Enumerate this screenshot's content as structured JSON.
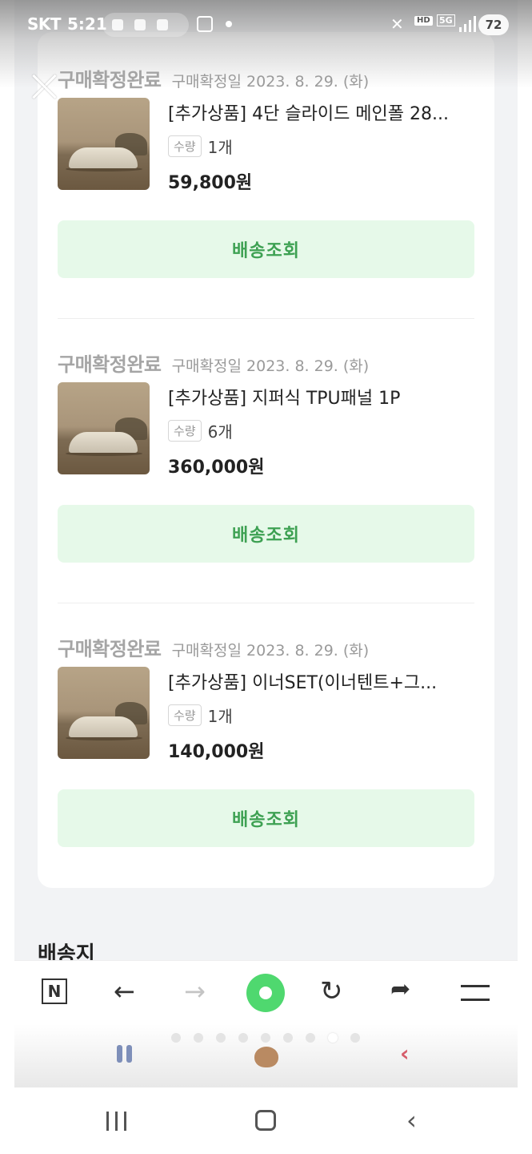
{
  "status_bar": {
    "carrier": "SKT",
    "time": "5:21",
    "hd": "HD",
    "network": "5G",
    "battery": "72"
  },
  "orders": [
    {
      "status": "구매확정완료",
      "confirm_date": "구매확정일 2023. 8. 29. (화)",
      "product_name": "[추가상품] 4단 슬라이드 메인폴 28...",
      "qty_label": "수량",
      "qty": "1개",
      "price": "59,800원",
      "track_button": "배송조회"
    },
    {
      "status": "구매확정완료",
      "confirm_date": "구매확정일 2023. 8. 29. (화)",
      "product_name": "[추가상품] 지퍼식 TPU패널 1P",
      "qty_label": "수량",
      "qty": "6개",
      "price": "360,000원",
      "track_button": "배송조회"
    },
    {
      "status": "구매확정완료",
      "confirm_date": "구매확정일 2023. 8. 29. (화)",
      "product_name": "[추가상품] 이너SET(이너텐트+그...",
      "qty_label": "수량",
      "qty": "1개",
      "price": "140,000원",
      "track_button": "배송조회"
    }
  ],
  "section_title": "배송지",
  "toolbar": {
    "n_label": "N",
    "back_arrow": "←",
    "forward_arrow": "→",
    "reload": "↻",
    "share": "➦"
  },
  "tabs": {
    "count": 9,
    "active_index": 7
  },
  "nav": {
    "back": "‹"
  }
}
